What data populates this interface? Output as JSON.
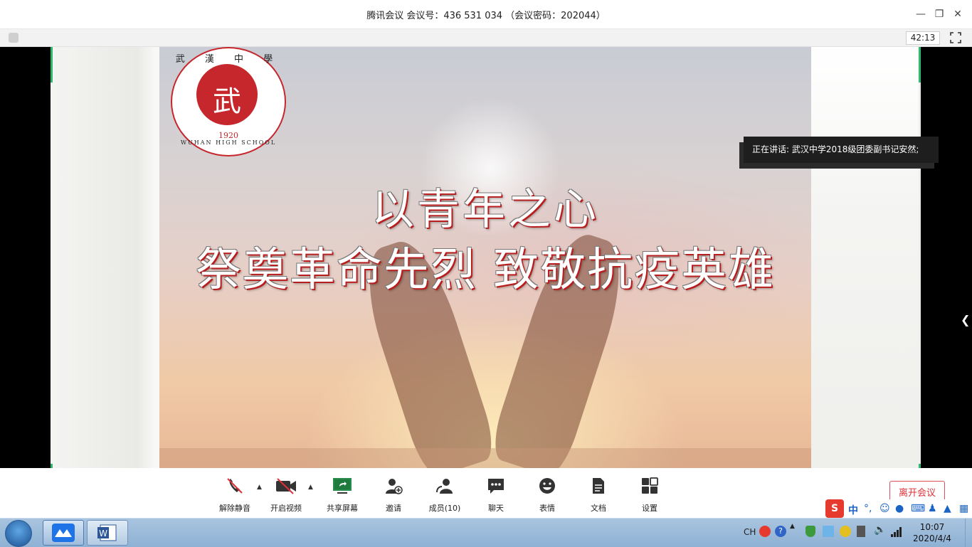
{
  "window": {
    "title": "腾讯会议 会议号：436 531 034 （会议密码：202044）",
    "timer": "42:13"
  },
  "slide": {
    "logo": {
      "top_text": "武 漢 中 學",
      "year": "1920",
      "english": "WUHAN HIGH SCHOOL"
    },
    "headline_1": "以青年之心",
    "headline_2": "祭奠革命先烈 致敬抗疫英雄"
  },
  "speaker_label": "正在讲话: 武汉中学2018级团委副书记安然;",
  "toolbar": {
    "unmute": "解除静音",
    "start_video": "开启视频",
    "share_screen": "共享屏幕",
    "invite": "邀请",
    "members": "成员(10)",
    "chat": "聊天",
    "reactions": "表情",
    "documents": "文档",
    "settings": "设置",
    "leave": "离开会议"
  },
  "ime": {
    "lang": "中",
    "punct": "°,"
  },
  "taskbar": {
    "lang": "CH",
    "time": "10:07",
    "date": "2020/4/4"
  },
  "colors": {
    "accent_green": "#2dbb6b",
    "leave_red": "#e0303a",
    "school_red": "#c5272d"
  }
}
